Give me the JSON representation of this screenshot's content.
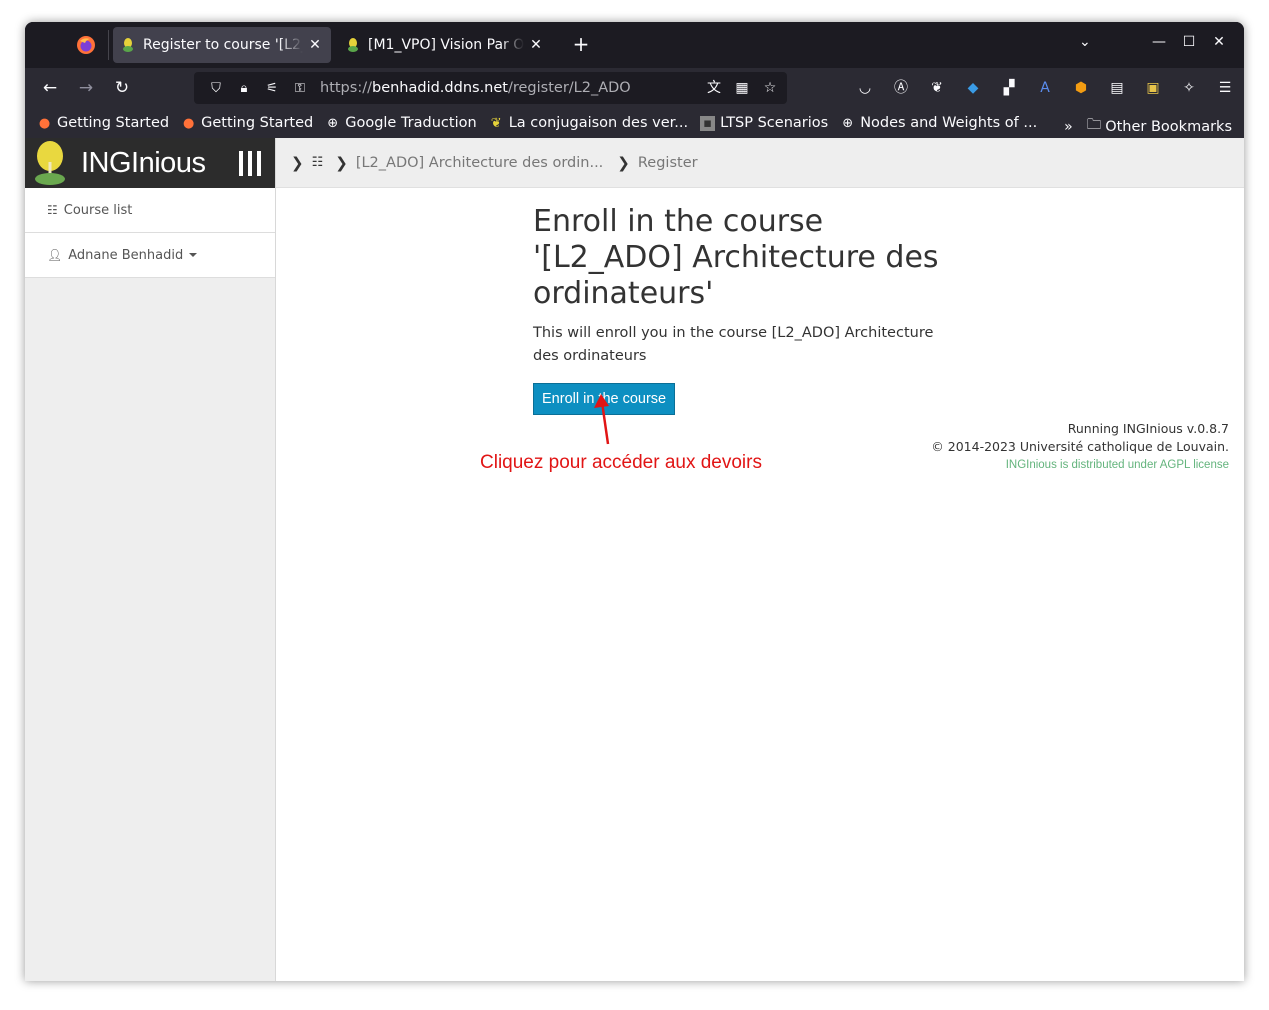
{
  "browser": {
    "tabs": [
      {
        "title": "Register to course '[L2_ADO] Architecture des ordinateurs'",
        "active": true
      },
      {
        "title": "[M1_VPO] Vision Par Ordinateur",
        "active": false
      }
    ],
    "url_prefix": "https://",
    "url_host": "benhadid.ddns.net",
    "url_path": "/register/L2_ADO",
    "bookmarks": [
      {
        "label": "Getting Started",
        "icon": "firefox-icon"
      },
      {
        "label": "Getting Started",
        "icon": "firefox-icon"
      },
      {
        "label": "Google Traduction",
        "icon": "globe-icon"
      },
      {
        "label": "La conjugaison des ver...",
        "icon": "bookmark-icon"
      },
      {
        "label": "LTSP Scenarios",
        "icon": "image-icon"
      },
      {
        "label": "Nodes and Weights of ...",
        "icon": "globe-icon"
      }
    ],
    "other_bookmarks": "Other Bookmarks"
  },
  "sidebar": {
    "brand": "INGInious",
    "items": [
      {
        "label": "Course list",
        "icon": "list-icon"
      },
      {
        "label": "Adnane Benhadid",
        "icon": "user-icon"
      }
    ]
  },
  "breadcrumb": {
    "course": "[L2_ADO] Architecture des ordin...",
    "current": "Register"
  },
  "main": {
    "heading": "Enroll in the course '[L2_ADO] Architecture des ordinateurs'",
    "description": "This will enroll you in the course [L2_ADO] Architecture des ordinateurs",
    "enroll_button": "Enroll in the course"
  },
  "footer": {
    "version": "Running INGInious v.0.8.7",
    "copyright": "© 2014-2023 Université catholique de Louvain.",
    "license": "INGInious is distributed under AGPL license"
  },
  "annotation": {
    "text": "Cliquez pour accéder aux devoirs",
    "color": "#e11515"
  },
  "colors": {
    "accent": "#0d8fc1",
    "brand_bg": "#2c2c2c"
  }
}
